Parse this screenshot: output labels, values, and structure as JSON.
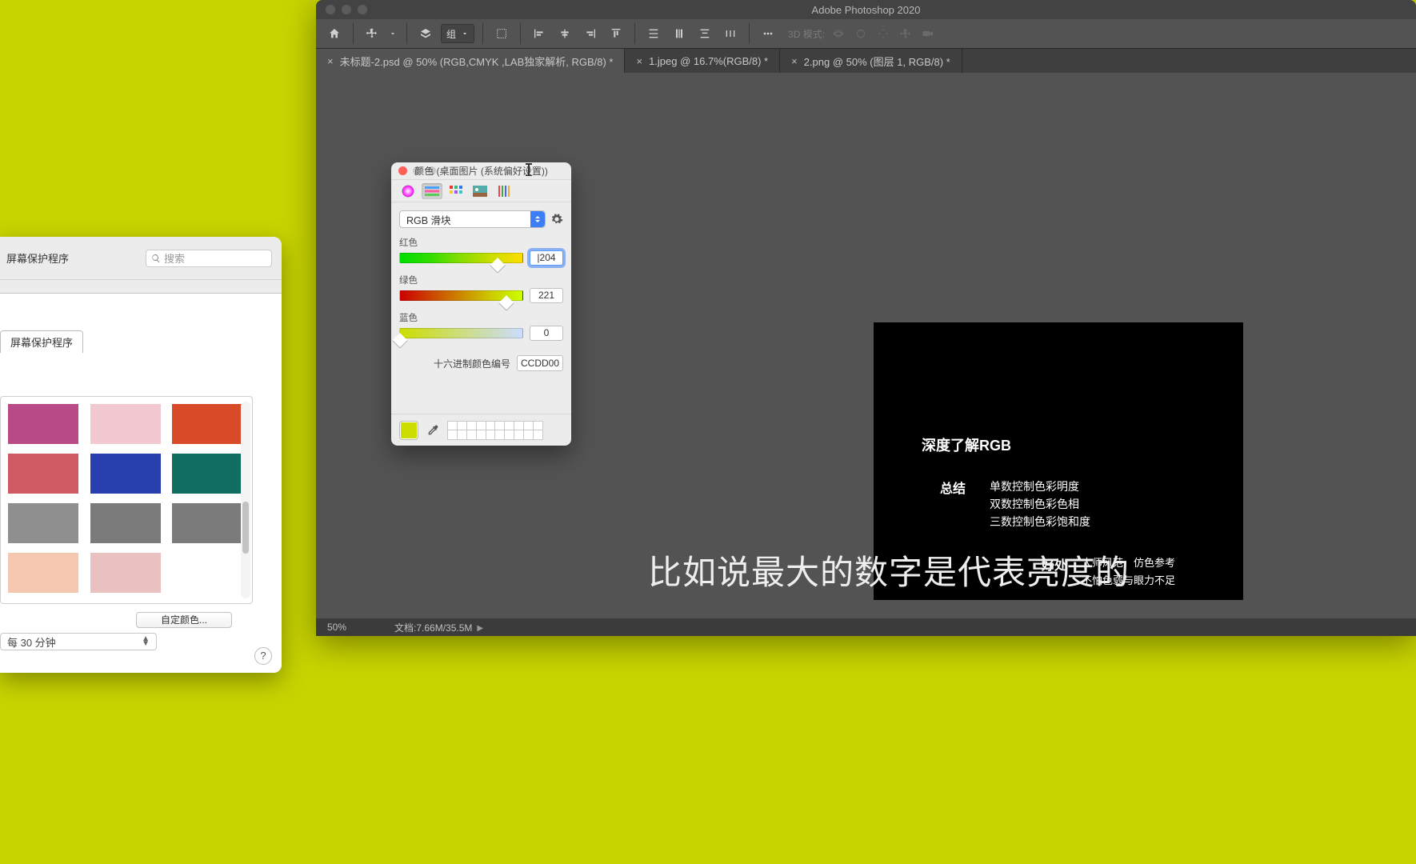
{
  "photoshop": {
    "title": "Adobe Photoshop 2020",
    "toolbar": {
      "group_label": "组",
      "mode_label": "3D 模式:"
    },
    "tabs": [
      {
        "label": "未标题-2.psd @ 50% (RGB,CMYK ,LAB独家解析, RGB/8) *",
        "active": true
      },
      {
        "label": "1.jpeg @ 16.7%(RGB/8) *",
        "active": false
      },
      {
        "label": "2.png @ 50% (图层 1, RGB/8) *",
        "active": false
      }
    ],
    "document": {
      "heading": "深度了解RGB",
      "summary_label": "总结",
      "summary_lines": [
        "单数控制色彩明度",
        "双数控制色彩色相",
        "三数控制色彩饱和度"
      ],
      "benefit_label": "好处",
      "benefit_line1": "大师风范　仿色参考",
      "benefit_line2": "不怕色弱与眼力不足"
    },
    "caption": "比如说最大的数字是代表亮度的",
    "status": {
      "zoom": "50%",
      "docinfo": "文档:7.66M/35.5M"
    }
  },
  "sysprefs": {
    "toolbar_title_suffix": "屏幕保护程序",
    "search_placeholder": "搜索",
    "tab": "屏幕保护程序",
    "swatches": [
      "#b84a87",
      "#f3c9d1",
      "#d94a29",
      "#cf5a63",
      "#2a3fae",
      "#0f6e60",
      "#8f8f8f",
      "#7b7b7b",
      "#7b7b7b",
      "#f6c7b0",
      "#e9c1c1"
    ],
    "custom_btn": "自定颜色...",
    "interval": "每 30 分钟"
  },
  "colorpicker": {
    "title": "颜色 (桌面图片 (系统偏好设置))",
    "mode_select": "RGB 滑块",
    "channels": {
      "red": {
        "label": "红色",
        "value": "204",
        "pos": 80
      },
      "green": {
        "label": "绿色",
        "value": "221",
        "pos": 87
      },
      "blue": {
        "label": "蓝色",
        "value": "0",
        "pos": 0
      }
    },
    "hex_label": "十六进制颜色编号",
    "hex_value": "CCDD00",
    "swatch_color": "#ccdd00"
  }
}
